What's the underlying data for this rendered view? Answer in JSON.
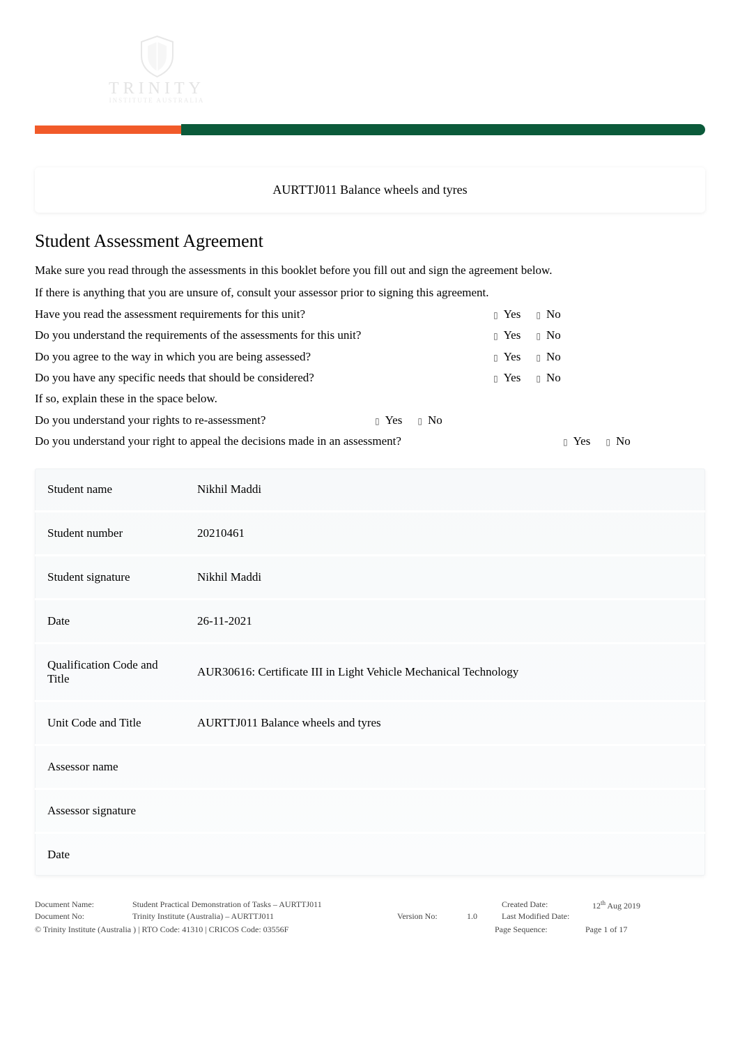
{
  "header": {
    "logo_text": "TRINITY",
    "logo_sub": "INSTITUTE AUSTRALIA",
    "addr_line1": "",
    "addr_line2": "",
    "web_line": ""
  },
  "title_bar": "AURTTJ011 Balance wheels and tyres",
  "section_heading": "Student Assessment Agreement",
  "intro": {
    "p1": "Make sure you read through the assessments in this booklet before you fill out and sign the agreement below.",
    "p2": "If there is anything that you are unsure of, consult your assessor prior to signing this agreement."
  },
  "questions": [
    {
      "text": "Have you read the assessment requirements for this unit?",
      "yes": "Yes",
      "no": "No"
    },
    {
      "text": "Do you understand the requirements of the assessments for this unit?",
      "yes": "Yes",
      "no": "No"
    },
    {
      "text": "Do you agree to the way in which you are being assessed?",
      "yes": "Yes",
      "no": "No"
    },
    {
      "text": "Do you have any specific needs that should be considered?",
      "yes": "Yes",
      "no": "No"
    }
  ],
  "explain_line": "If so, explain these in the space below.",
  "q_reassess": {
    "text": "Do you understand your rights to re-assessment?",
    "yes": "Yes",
    "no": "No"
  },
  "q_appeal": {
    "text": "Do you understand your right to appeal the decisions made in an assessment?",
    "yes": "Yes",
    "no": "No"
  },
  "form": {
    "rows": [
      {
        "label": "Student name",
        "value": "Nikhil Maddi"
      },
      {
        "label": "Student number",
        "value": "20210461"
      },
      {
        "label": "Student signature",
        "value": "Nikhil Maddi"
      },
      {
        "label": "Date",
        "value": "26-11-2021"
      },
      {
        "label": "Qualification Code and Title",
        "value": "AUR30616: Certificate III in Light Vehicle Mechanical Technology"
      },
      {
        "label": "Unit Code and Title",
        "value": "AURTTJ011 Balance wheels and tyres"
      },
      {
        "label": "Assessor name",
        "value": ""
      },
      {
        "label": "Assessor signature",
        "value": ""
      },
      {
        "label": "Date",
        "value": ""
      }
    ]
  },
  "footer": {
    "doc_name_label": "Document Name:",
    "doc_name_value": "Student Practical Demonstration of Tasks – AURTTJ011",
    "doc_no_label": "Document No:",
    "doc_no_value": "Trinity Institute (Australia)  – AURTTJ011",
    "version_label": "Version No:",
    "version_value": "1.0",
    "created_label": "Created Date:",
    "created_value_pre": "12",
    "created_value_sup": "th",
    "created_value_post": " Aug 2019",
    "modified_label": "Last Modified Date:",
    "modified_value": "",
    "copyright": "© Trinity Institute (Australia     ) | RTO Code: 41310 | CRICOS Code: 03556F",
    "page_seq_label": "Page Sequence:",
    "page_seq_value": "Page  1 of 17"
  }
}
